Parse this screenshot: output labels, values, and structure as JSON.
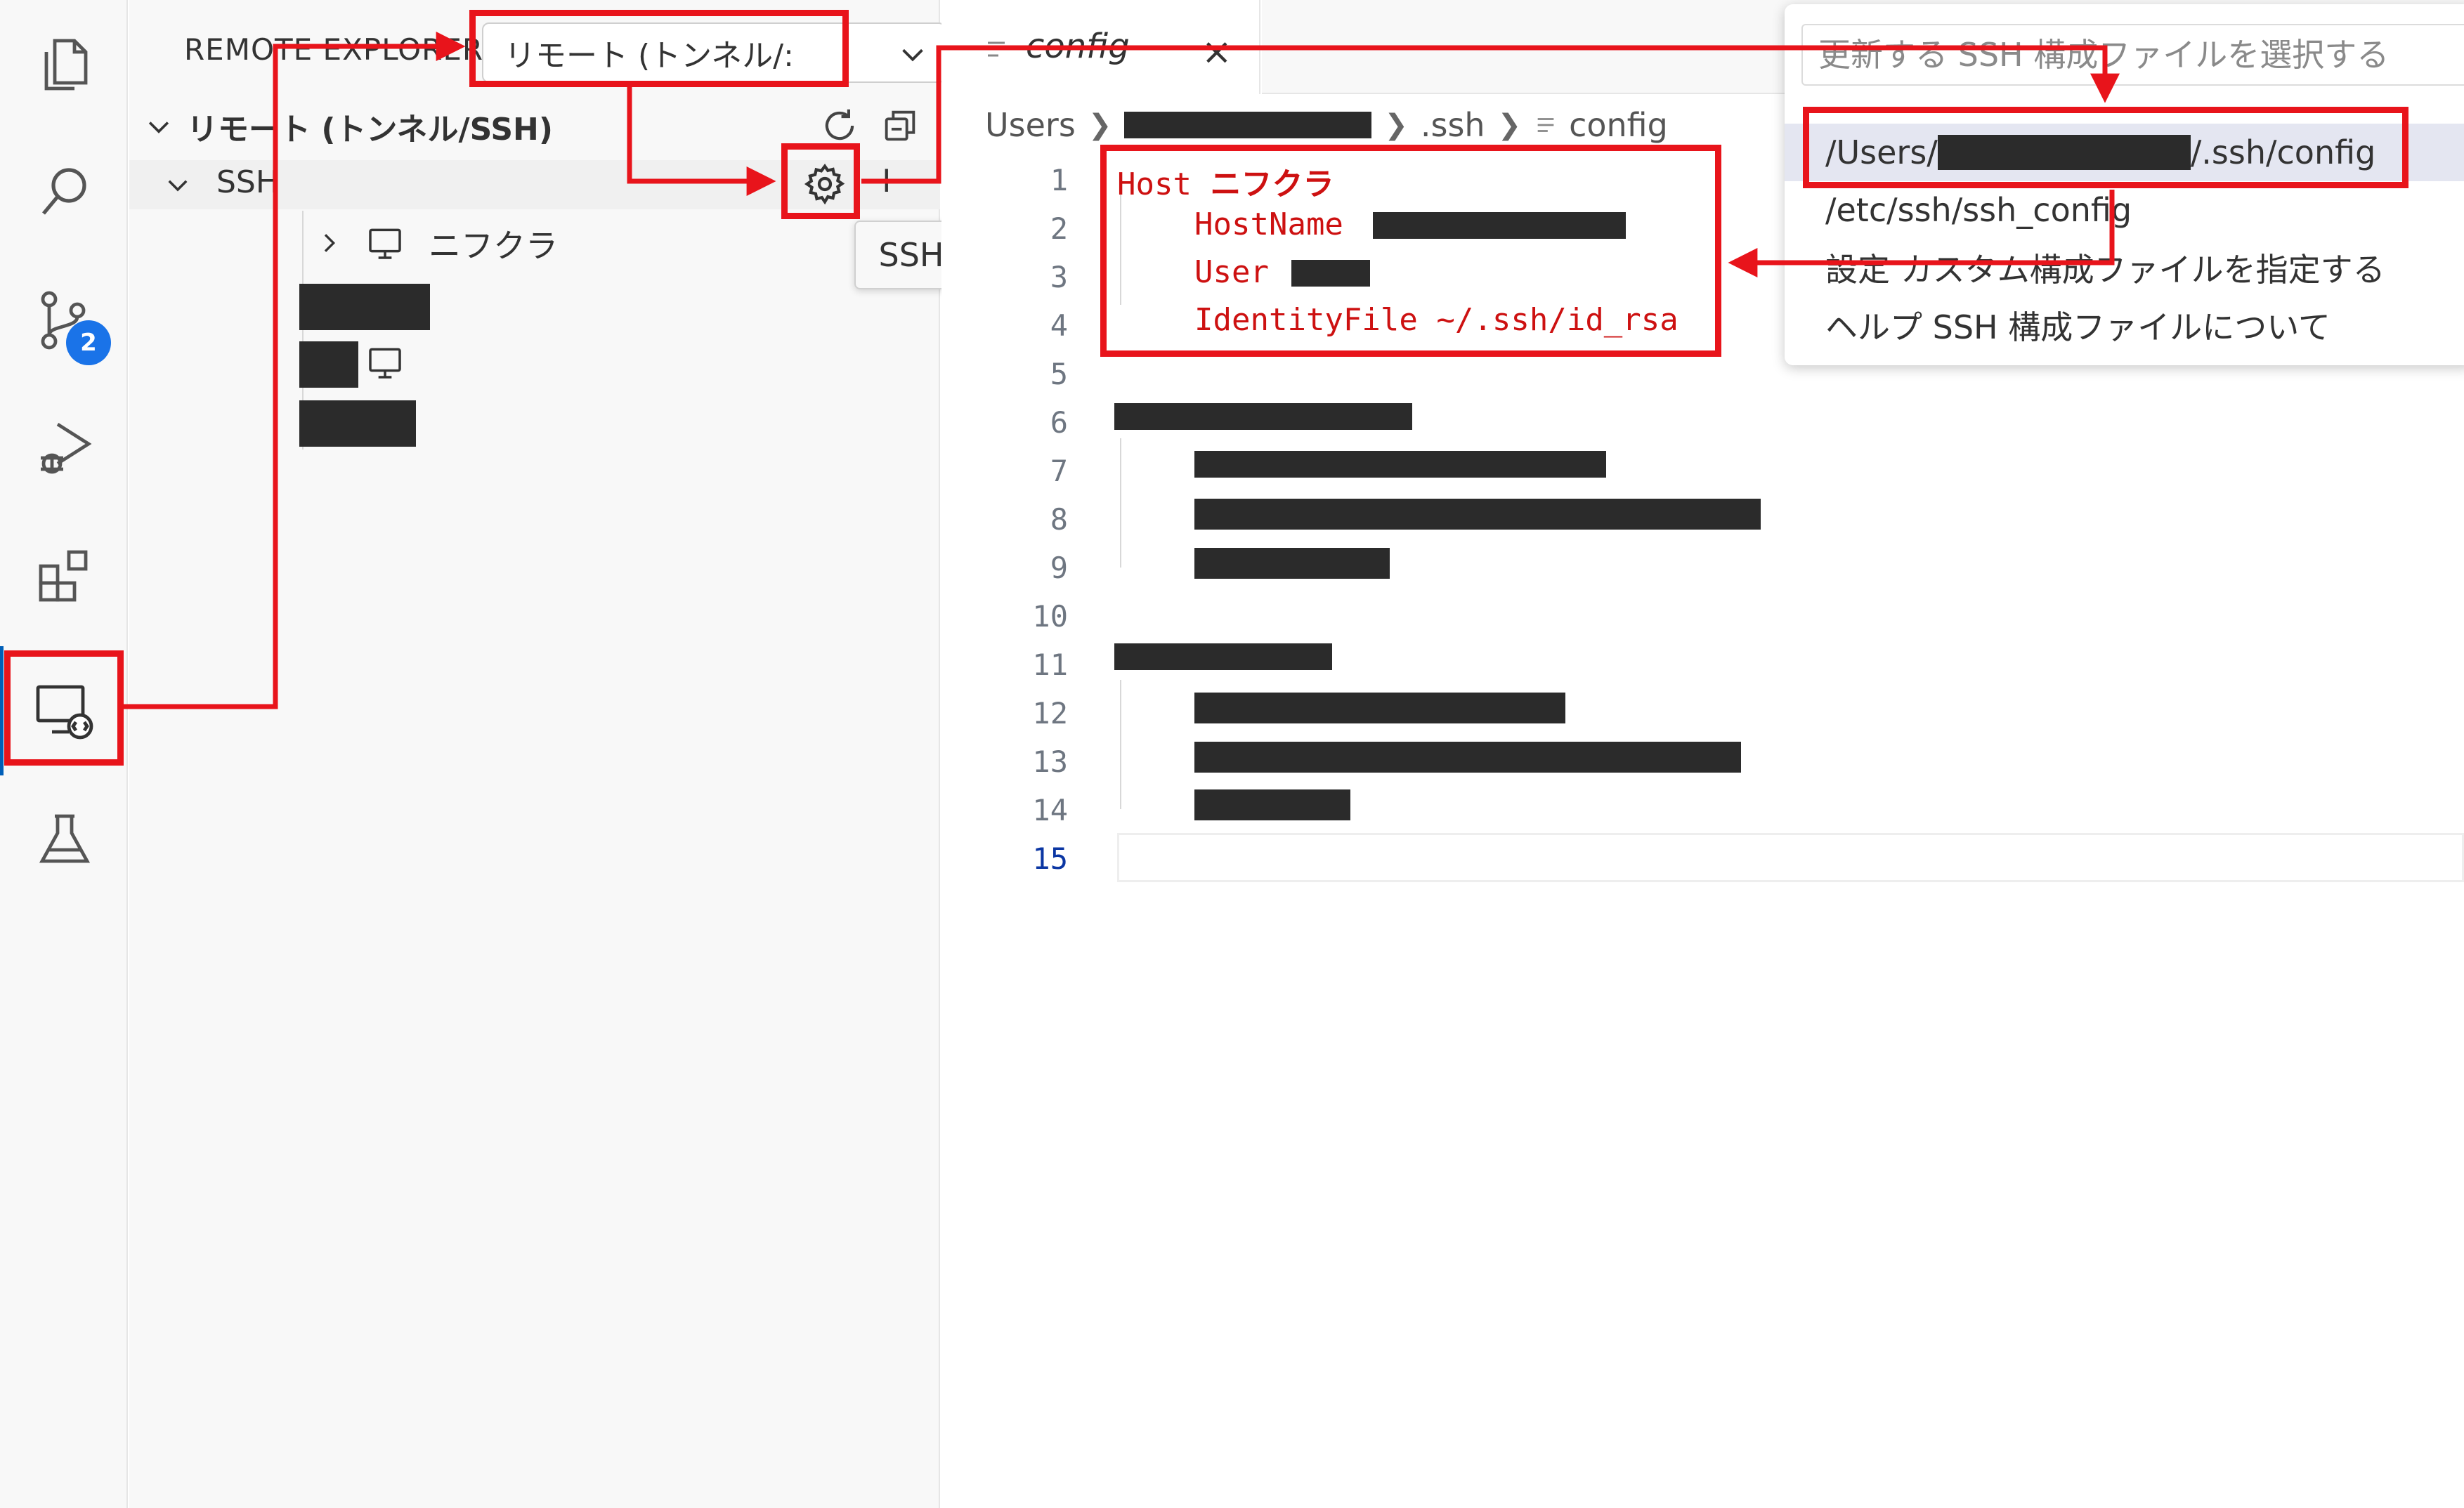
{
  "sidebar": {
    "title": "REMOTE EXPLORER",
    "filter_value": "リモート (トンネル/:",
    "more_label": "···",
    "section_title": "リモート (トンネル/SSH)",
    "ssh_group_label": "SSH",
    "gear_tooltip": "SSH",
    "add_label": "+",
    "hosts": [
      {
        "label": "ニフクラ",
        "expandable": true
      },
      {
        "label": "",
        "expandable": true,
        "redacted": true
      },
      {
        "label": "",
        "expandable": false,
        "redacted": true
      },
      {
        "label": "",
        "expandable": false,
        "redacted": true
      }
    ]
  },
  "activity_bar": {
    "items": [
      "explorer-icon",
      "search-icon",
      "source-control-icon",
      "run-debug-icon",
      "extensions-icon",
      "remote-explorer-icon",
      "testing-icon"
    ],
    "source_control_badge": "2"
  },
  "editor": {
    "tab_label": "config",
    "tab_close": "×",
    "breadcrumb": [
      "Users",
      ".ssh",
      "config"
    ],
    "line_numbers": [
      "1",
      "2",
      "3",
      "4",
      "5",
      "6",
      "7",
      "8",
      "9",
      "10",
      "11",
      "12",
      "13",
      "14",
      "15"
    ],
    "active_line": "15",
    "code": {
      "line1_keyword": "Host",
      "line1_value": "ニフクラ",
      "line2_key": "HostName",
      "line3_key": "User",
      "line4_key": "IdentityFile",
      "line4_value": "~/.ssh/id_rsa"
    }
  },
  "quick_pick": {
    "placeholder": "更新する SSH 構成ファイルを選択する",
    "items": [
      {
        "prefix": "/Users/",
        "suffix": "/.ssh/config",
        "selected": true
      },
      {
        "label": "/etc/ssh/ssh_config"
      },
      {
        "label": "設定  カスタム構成ファイルを指定する"
      },
      {
        "label": "ヘルプ  SSH 構成ファイルについて"
      }
    ]
  },
  "colors": {
    "annotation_red": "#e8141b",
    "code_red": "#cd1111",
    "badge_blue": "#1a73e8",
    "redaction": "#2b2b2b"
  }
}
